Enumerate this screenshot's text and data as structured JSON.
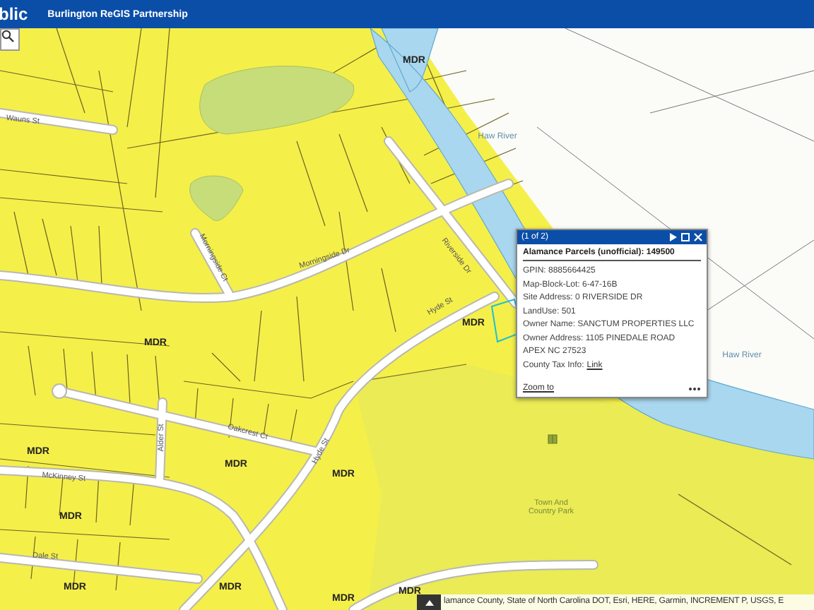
{
  "header": {
    "app_title": "blic",
    "subtitle": "Burlington ReGIS Partnership"
  },
  "map": {
    "labels": [
      {
        "text": "MDR",
        "kind": "zone"
      },
      {
        "text": "MDR",
        "kind": "zone"
      },
      {
        "text": "MDR",
        "kind": "zone"
      },
      {
        "text": "MDR",
        "kind": "zone"
      },
      {
        "text": "MDR",
        "kind": "zone"
      },
      {
        "text": "MDR",
        "kind": "zone"
      },
      {
        "text": "MDR",
        "kind": "zone"
      },
      {
        "text": "MDR",
        "kind": "zone"
      },
      {
        "text": "MDR",
        "kind": "zone"
      },
      {
        "text": "MDR",
        "kind": "zone"
      },
      {
        "text": "MDR",
        "kind": "zone"
      },
      {
        "text": "Wauns St",
        "kind": "street"
      },
      {
        "text": "Morningside Ct",
        "kind": "street"
      },
      {
        "text": "Morningside Dr",
        "kind": "street"
      },
      {
        "text": "Riverside Dr",
        "kind": "street"
      },
      {
        "text": "Hyde St",
        "kind": "street"
      },
      {
        "text": "Oakcrest Ct",
        "kind": "street"
      },
      {
        "text": "Alder St",
        "kind": "street"
      },
      {
        "text": "McKinney St",
        "kind": "street"
      },
      {
        "text": "Hyde St",
        "kind": "street"
      },
      {
        "text": "Dale St",
        "kind": "street"
      },
      {
        "text": "Haw River",
        "kind": "water"
      },
      {
        "text": "Haw River",
        "kind": "water"
      },
      {
        "text": "Town And Country Park",
        "kind": "park"
      }
    ]
  },
  "popup": {
    "counter": "(1 of 2)",
    "title": "Alamance Parcels (unofficial): 149500",
    "fields": [
      "GPIN: 8885664425",
      "Map-Block-Lot: 6-47-16B",
      "Site Address: 0 RIVERSIDE DR",
      "LandUse: 501",
      "Owner Name: SANCTUM PROPERTIES LLC",
      "Owner Address: 1105 PINEDALE ROAD",
      "APEX NC 27523"
    ],
    "tax_label": "County Tax Info:",
    "tax_link": "Link",
    "zoom_link": "Zoom to"
  },
  "attribution": "lamance County, State of North Carolina DOT, Esri, HERE, Garmin, INCREMENT P, USGS, E"
}
